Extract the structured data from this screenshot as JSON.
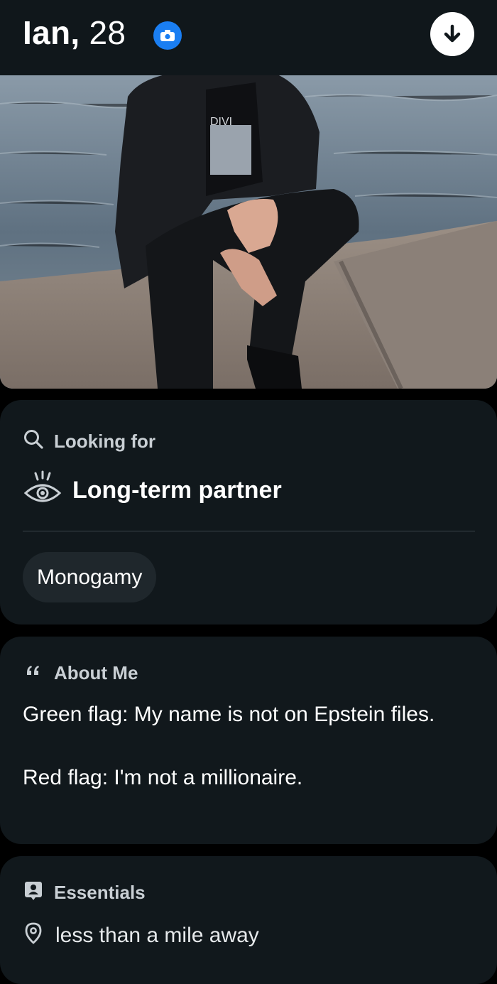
{
  "header": {
    "name": "Ian,",
    "age": "28",
    "verified_icon": "camera-verified-icon",
    "action_icon": "arrow-down-icon",
    "accent": "#1a7ef2"
  },
  "photo": {
    "shirt_text": "DIVI"
  },
  "looking_for": {
    "heading": "Looking for",
    "heading_icon": "search-icon",
    "value": "Long-term partner",
    "value_icon": "eye-icon",
    "chip": "Monogamy"
  },
  "about": {
    "heading": "About Me",
    "heading_icon": "quote-icon",
    "line1": "Green flag: My name is not on Epstein files.",
    "line2": "Red flag: I'm not a millionaire."
  },
  "essentials": {
    "heading": "Essentials",
    "heading_icon": "id-badge-icon",
    "distance": "less than a mile away",
    "distance_icon": "location-pin-icon"
  }
}
